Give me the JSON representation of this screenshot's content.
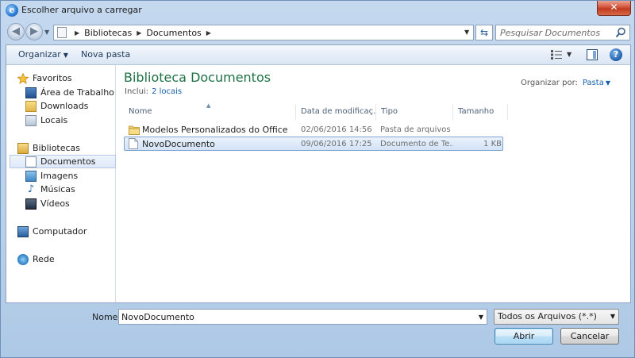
{
  "window": {
    "title": "Escolher arquivo a carregar",
    "close_glyph": "✕"
  },
  "address": {
    "segments": [
      "Bibliotecas",
      "Documentos"
    ],
    "search_placeholder": "Pesquisar Documentos"
  },
  "toolbar": {
    "organize_label": "Organizar",
    "new_folder_label": "Nova pasta",
    "help_glyph": "?"
  },
  "sidebar": {
    "favorites_label": "Favoritos",
    "favorites": [
      "Área de Trabalho",
      "Downloads",
      "Locais"
    ],
    "libraries_label": "Bibliotecas",
    "libraries": [
      "Documentos",
      "Imagens",
      "Músicas",
      "Vídeos"
    ],
    "computer_label": "Computador",
    "network_label": "Rede",
    "selected": "Documentos"
  },
  "library": {
    "title": "Biblioteca Documentos",
    "includes_label": "Inclui:",
    "includes_link": "2 locais",
    "arrange_label": "Organizar por:",
    "arrange_value": "Pasta"
  },
  "columns": {
    "name": "Nome",
    "date": "Data de modificaç...",
    "type": "Tipo",
    "size": "Tamanho"
  },
  "files": [
    {
      "name": "Modelos Personalizados do Office",
      "date": "02/06/2016 14:56",
      "type": "Pasta de arquivos",
      "size": "",
      "icon": "folder-icon",
      "selected": false
    },
    {
      "name": "NovoDocumento",
      "date": "09/06/2016 17:25",
      "type": "Documento de Te...",
      "size": "1 KB",
      "icon": "text-document-icon",
      "selected": true
    }
  ],
  "footer": {
    "name_label": "Nome:",
    "name_value": "NovoDocumento",
    "filter_value": "Todos os Arquivos (*.*)",
    "open_label": "Abrir",
    "cancel_label": "Cancelar"
  },
  "colors": {
    "library_title": "#1e7145",
    "link": "#1560b0",
    "selection_border": "#7da2ce"
  }
}
